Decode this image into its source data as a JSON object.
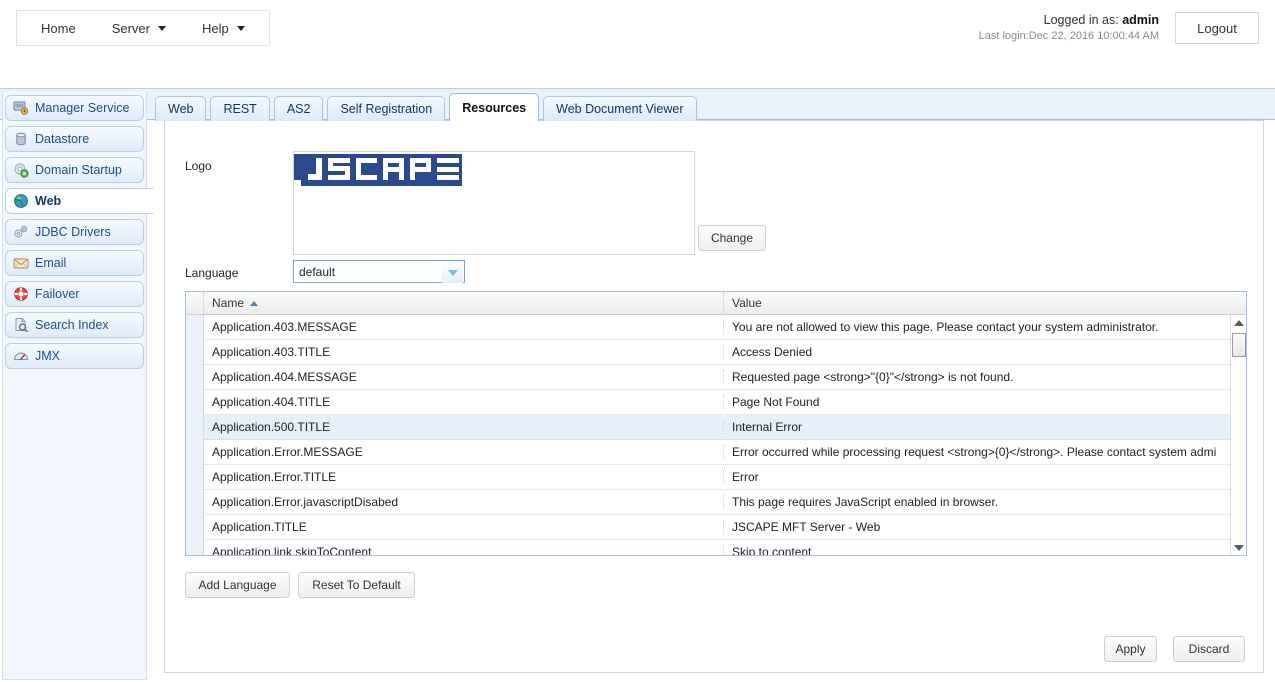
{
  "topbar": {
    "menu": [
      {
        "label": "Home",
        "caret": false
      },
      {
        "label": "Server",
        "caret": true
      },
      {
        "label": "Help",
        "caret": true
      }
    ],
    "logged_in_prefix": "Logged in as: ",
    "logged_in_user": "admin",
    "last_login": "Last login:Dec 22, 2016 10:00:44 AM",
    "logout_label": "Logout"
  },
  "sidebar": {
    "items": [
      {
        "label": "Manager Service",
        "icon": "manager-service-icon",
        "active": false
      },
      {
        "label": "Datastore",
        "icon": "datastore-icon",
        "active": false
      },
      {
        "label": "Domain Startup",
        "icon": "domain-startup-icon",
        "active": false
      },
      {
        "label": "Web",
        "icon": "web-globe-icon",
        "active": true
      },
      {
        "label": "JDBC Drivers",
        "icon": "jdbc-drivers-icon",
        "active": false
      },
      {
        "label": "Email",
        "icon": "email-icon",
        "active": false
      },
      {
        "label": "Failover",
        "icon": "failover-icon",
        "active": false
      },
      {
        "label": "Search Index",
        "icon": "search-index-icon",
        "active": false
      },
      {
        "label": "JMX",
        "icon": "jmx-icon",
        "active": false
      }
    ]
  },
  "tabs": [
    {
      "label": "Web",
      "active": false
    },
    {
      "label": "REST",
      "active": false
    },
    {
      "label": "AS2",
      "active": false
    },
    {
      "label": "Self Registration",
      "active": false
    },
    {
      "label": "Resources",
      "active": true
    },
    {
      "label": "Web Document Viewer",
      "active": false
    }
  ],
  "form": {
    "logo_label": "Logo",
    "logo_alt": "JSCAPE",
    "change_label": "Change",
    "language_label": "Language",
    "language_value": "default",
    "language_options": [
      "default"
    ]
  },
  "grid": {
    "columns": [
      "Name",
      "Value"
    ],
    "sort_column": "Name",
    "sort_direction": "asc",
    "rows": [
      {
        "name": "Application.403.MESSAGE",
        "value": "You are not allowed to view this page. Please contact your system administrator.",
        "selected": false
      },
      {
        "name": "Application.403.TITLE",
        "value": "Access Denied",
        "selected": false
      },
      {
        "name": "Application.404.MESSAGE",
        "value": "Requested page <strong>\"{0}\"</strong> is not found.",
        "selected": false
      },
      {
        "name": "Application.404.TITLE",
        "value": "Page Not Found",
        "selected": false
      },
      {
        "name": "Application.500.TITLE",
        "value": "Internal Error",
        "selected": true
      },
      {
        "name": "Application.Error.MESSAGE",
        "value": "Error occurred while processing request <strong>{0}</strong>. Please contact system admi",
        "selected": false
      },
      {
        "name": "Application.Error.TITLE",
        "value": "Error",
        "selected": false
      },
      {
        "name": "Application.Error.javascriptDisabed",
        "value": "This page requires JavaScript enabled in browser.",
        "selected": false
      },
      {
        "name": "Application.TITLE",
        "value": "JSCAPE MFT Server - Web",
        "selected": false
      },
      {
        "name": "Application.link.skipToContent",
        "value": "Skip to content",
        "selected": false
      }
    ]
  },
  "actions": {
    "add_language": "Add Language",
    "reset_to_default": "Reset To Default",
    "apply": "Apply",
    "discard": "Discard"
  },
  "colors": {
    "accent_blue": "#1f4e8c",
    "band_blue": "#eaf1fb",
    "logo_blue": "#2b4a8b",
    "selected_row": "#e7effb"
  }
}
